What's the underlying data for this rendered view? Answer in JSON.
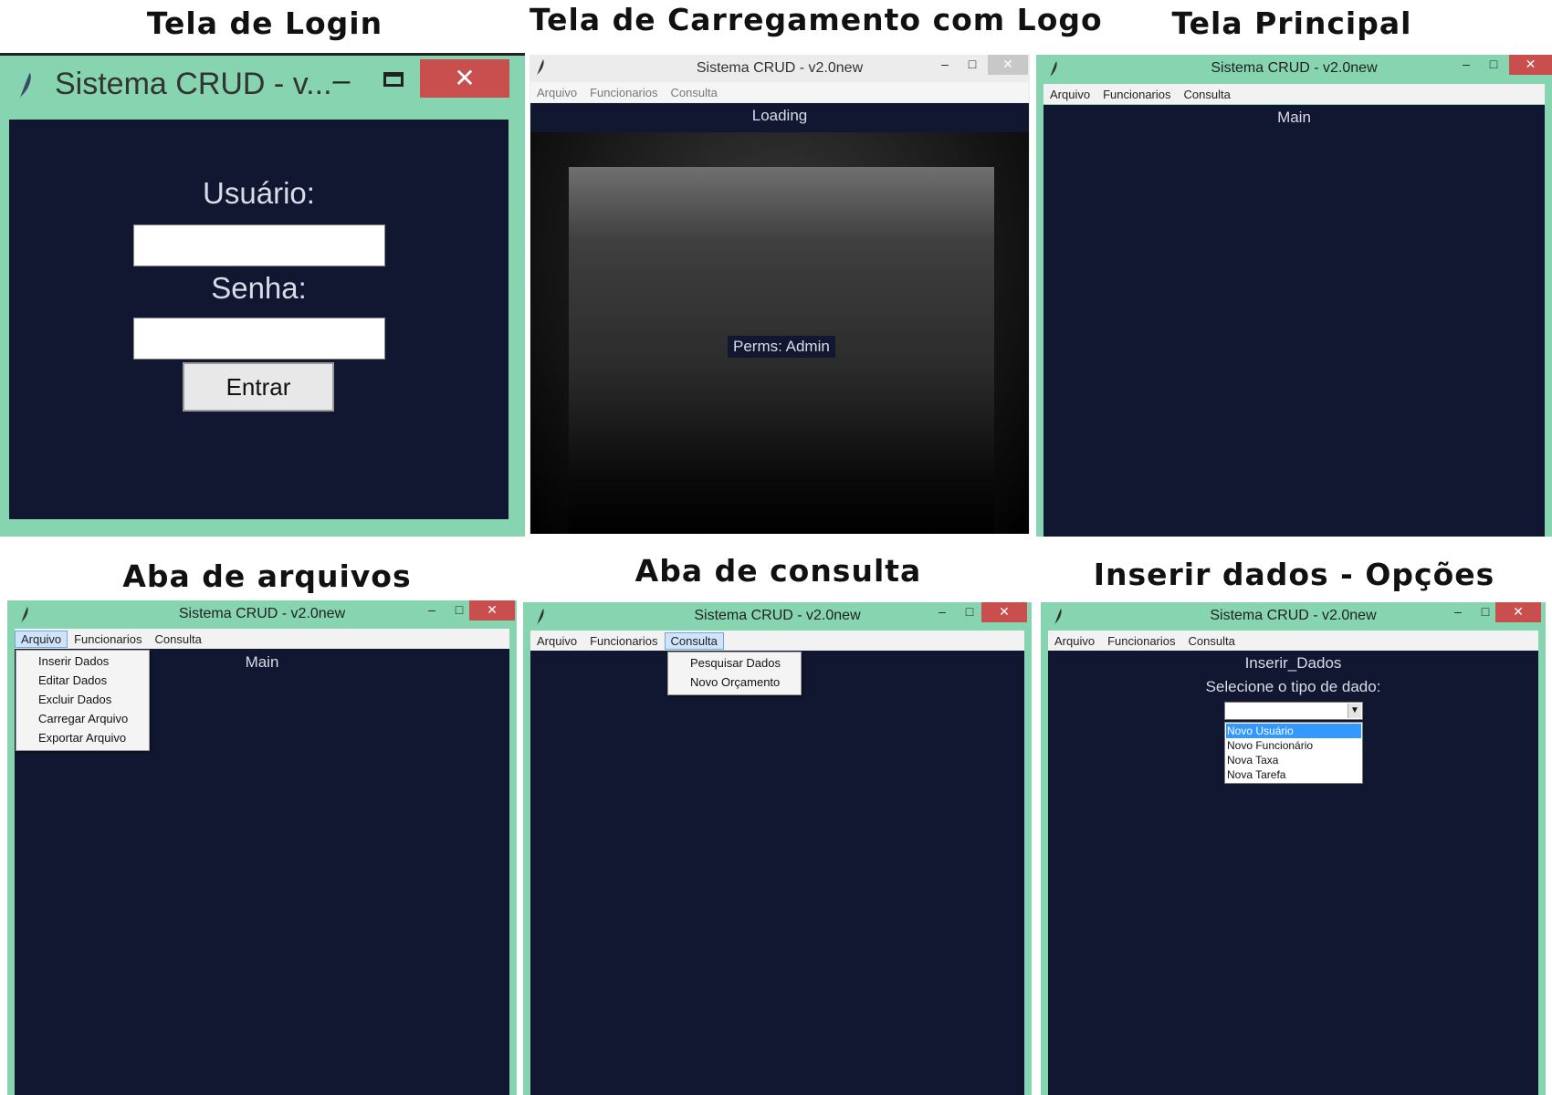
{
  "captions": {
    "login": "Tela de Login",
    "loading": "Tela de Carregamento com Logo",
    "main": "Tela Principal",
    "arquivos": "Aba de arquivos",
    "consulta": "Aba de consulta",
    "inserir": "Inserir dados - Opções"
  },
  "app": {
    "title": "Sistema CRUD - v2.0new",
    "title_truncated": "Sistema CRUD - v...",
    "minimize": "–",
    "maximize": "□",
    "close": "✕",
    "feather_icon": "feather-icon"
  },
  "menu": {
    "arquivo": "Arquivo",
    "funcionarios": "Funcionarios",
    "consulta": "Consulta"
  },
  "login": {
    "user_label": "Usuário:",
    "user_value": "",
    "pass_label": "Senha:",
    "pass_value": "",
    "button": "Entrar"
  },
  "loading": {
    "label": "Loading",
    "perms": "Perms: Admin"
  },
  "main": {
    "label": "Main"
  },
  "arquivo_menu": [
    "Inserir Dados",
    "Editar Dados",
    "Excluir Dados",
    "Carregar Arquivo",
    "Exportar Arquivo"
  ],
  "consulta_menu": [
    "Pesquisar Dados",
    "Novo Orçamento"
  ],
  "inserir": {
    "label": "Inserir_Dados",
    "select_label": "Selecione o tipo de dado:",
    "select_value": "",
    "options": [
      "Novo Usuário",
      "Novo Funcionário",
      "Nova Taxa",
      "Nova Tarefa"
    ],
    "highlighted_index": 0
  },
  "colors": {
    "frame": "#86d5b0",
    "content_bg": "#111730",
    "close_btn": "#c94f4f",
    "highlight": "#3399ff"
  }
}
